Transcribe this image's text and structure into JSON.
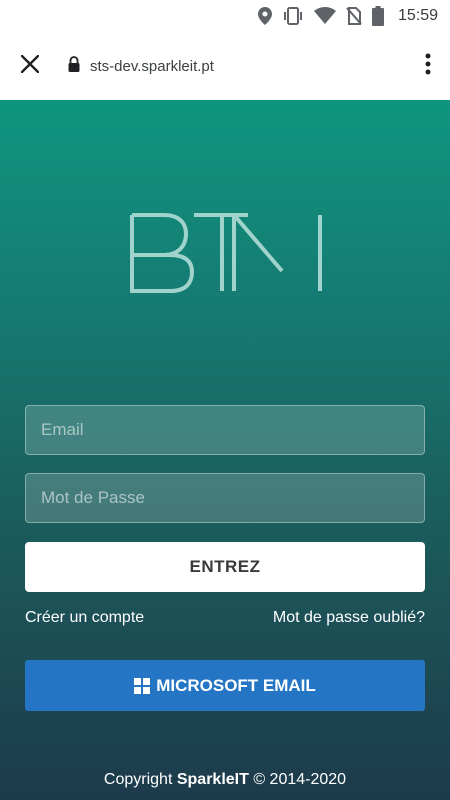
{
  "status_bar": {
    "time": "15:59",
    "icons": [
      "location-icon",
      "vibrate-icon",
      "wifi-icon",
      "no-sim-icon",
      "battery-icon"
    ]
  },
  "browser": {
    "url": "sts-dev.sparkleit.pt",
    "close_icon": "close-icon",
    "lock_icon": "lock-icon",
    "menu_icon": "more-vert-icon"
  },
  "logo": {
    "text": "BTM",
    "color": "#9fd3cc"
  },
  "form": {
    "email_placeholder": "Email",
    "email_value": "",
    "password_placeholder": "Mot de Passe",
    "password_value": "",
    "submit_label": "ENTREZ",
    "create_account_label": "Créer un compte",
    "forgot_password_label": "Mot de passe oublié?",
    "microsoft_label": "MICROSOFT EMAIL"
  },
  "footer": {
    "prefix": "Copyright ",
    "brand": "SparkleIT",
    "suffix": " © 2014-2020"
  },
  "colors": {
    "gradient_top": "#0f9580",
    "gradient_bottom": "#1d3a4b",
    "microsoft_button": "#2475c4"
  }
}
